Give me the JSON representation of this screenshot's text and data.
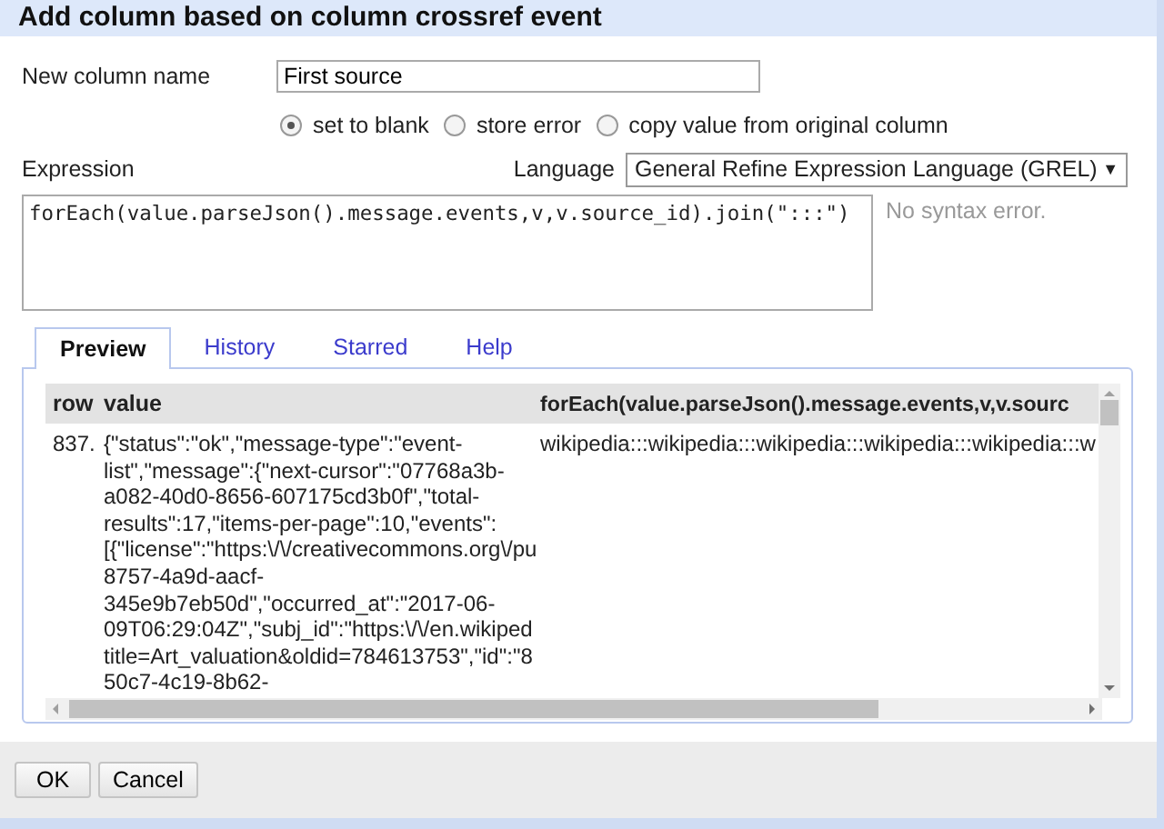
{
  "window": {
    "title": "Add column based on column crossref event"
  },
  "new_column_name": {
    "label": "New column name",
    "value": "First source"
  },
  "on_error": [
    {
      "label": "set to blank",
      "selected": true
    },
    {
      "label": "store error",
      "selected": false
    },
    {
      "label": "copy value from original column",
      "selected": false
    }
  ],
  "expression": {
    "label": "Expression",
    "value": "forEach(value.parseJson().message.events,v,v.source_id).join(\":::\")",
    "status": "No syntax error."
  },
  "language": {
    "label": "Language",
    "value": "General Refine Expression Language (GREL)",
    "caret": "▼"
  },
  "tabs": [
    {
      "label": "Preview",
      "selected": true
    },
    {
      "label": "History",
      "selected": false
    },
    {
      "label": "Starred",
      "selected": false
    },
    {
      "label": "Help",
      "selected": false
    }
  ],
  "table": {
    "columns": [
      "row",
      "value",
      "forEach(value.parseJson().message.events,v,v.sourc"
    ],
    "rows": [
      {
        "row": "837.",
        "value": [
          "{\"status\":\"ok\",\"message-type\":\"event-",
          "list\",\"message\":{\"next-cursor\":\"07768a3b-",
          "a082-40d0-8656-607175cd3b0f\",\"total-",
          "results\":17,\"items-per-page\":10,\"events\":",
          "[{\"license\":\"https:\\/\\/creativecommons.org\\/pu",
          "8757-4a9d-aacf-",
          "345e9b7eb50d\",\"occurred_at\":\"2017-06-",
          "09T06:29:04Z\",\"subj_id\":\"https:\\/\\/en.wikiped",
          "title=Art_valuation&oldid=784613753\",\"id\":\"8",
          "50c7-4c19-8b62-"
        ],
        "result": "wikipedia:::wikipedia:::wikipedia:::wikipedia:::wikipedia:::w"
      }
    ]
  },
  "buttons": [
    "OK",
    "Cancel"
  ]
}
